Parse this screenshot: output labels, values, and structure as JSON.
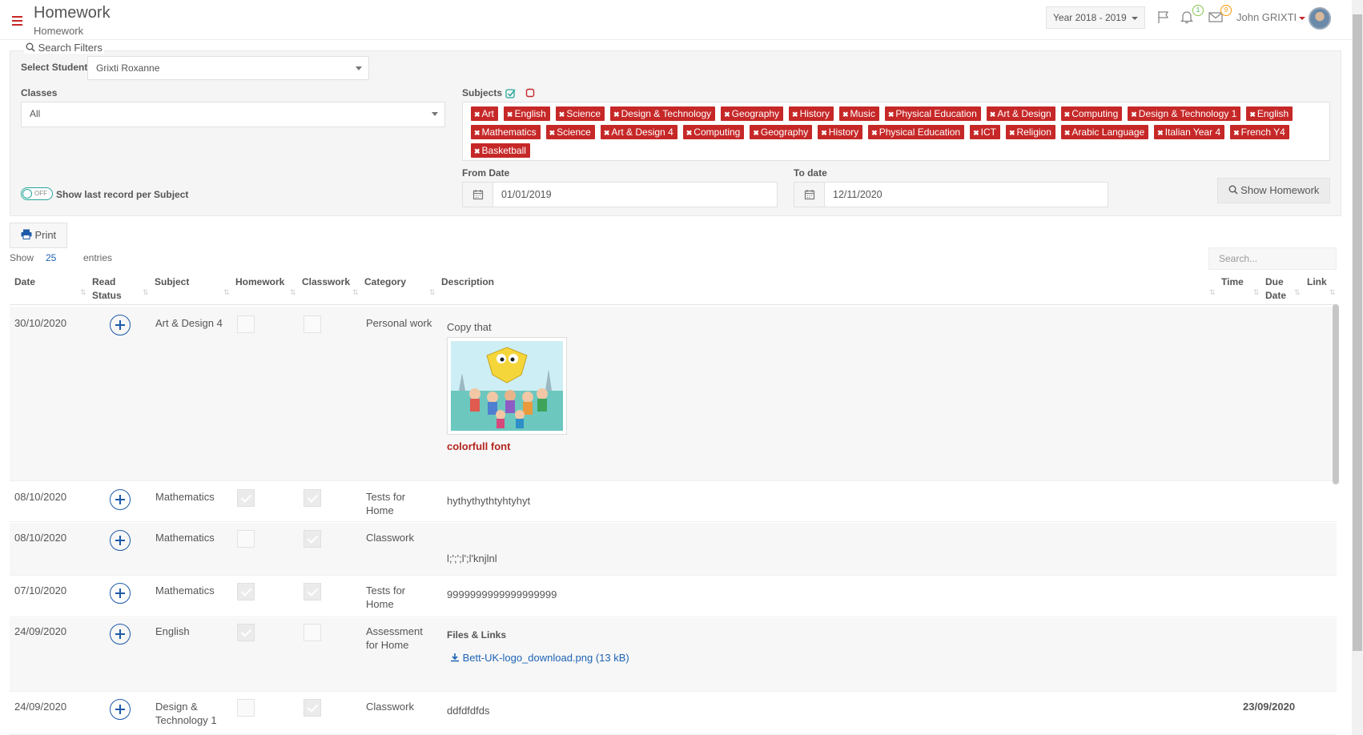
{
  "header": {
    "title": "Homework",
    "subtitle": "Homework",
    "year_select": "Year 2018 - 2019",
    "notifications_count": "1",
    "messages_count": "9",
    "user_name": "John GRIXTI"
  },
  "filters": {
    "title": "Search Filters",
    "select_student_label": "Select Student",
    "select_student_value": "Grixti Roxanne",
    "classes_label": "Classes",
    "classes_value": "All",
    "subjects_label": "Subjects",
    "subjects": [
      "Art",
      "English",
      "Science",
      "Design & Technology",
      "Geography",
      "History",
      "Music",
      "Physical Education",
      "Art & Design",
      "Computing",
      "Design & Technology 1",
      "English",
      "Mathematics",
      "Science",
      "Art & Design 4",
      "Computing",
      "Geography",
      "History",
      "Physical Education",
      "ICT",
      "Religion",
      "Arabic Language",
      "Italian Year 4",
      "French Y4",
      "Basketball"
    ],
    "toggle_state": "OFF",
    "toggle_label": "Show last record per Subject",
    "from_date_label": "From Date",
    "from_date_value": "01/01/2019",
    "to_date_label": "To date",
    "to_date_value": "12/11/2020",
    "show_button": "Show Homework"
  },
  "toolbar": {
    "print": "Print",
    "show_label": "Show",
    "entries_value": "25",
    "entries_label": "entries",
    "search_placeholder": "Search..."
  },
  "table": {
    "columns": {
      "date": "Date",
      "read": "Read",
      "status": "Status",
      "subject": "Subject",
      "homework": "Homework",
      "classwork": "Classwork",
      "category": "Category",
      "description": "Description",
      "time": "Time",
      "due": "Due",
      "date2": "Date",
      "link": "Link"
    },
    "rows": [
      {
        "date": "30/10/2020",
        "subject": "Art & Design 4",
        "subject2": "",
        "homework": false,
        "classwork": false,
        "category": "Personal work",
        "category2": "",
        "description": "Copy that",
        "note": "colorfull font",
        "due": ""
      },
      {
        "date": "08/10/2020",
        "subject": "Mathematics",
        "subject2": "",
        "homework": true,
        "classwork": true,
        "category": "Tests for",
        "category2": "Home",
        "description": "hythythythtyhtyhyt",
        "due": ""
      },
      {
        "date": "08/10/2020",
        "subject": "Mathematics",
        "subject2": "",
        "homework": false,
        "classwork": true,
        "category": "Classwork",
        "category2": "",
        "description": "l;';';l';l'knjlnl",
        "due": ""
      },
      {
        "date": "07/10/2020",
        "subject": "Mathematics",
        "subject2": "",
        "homework": true,
        "classwork": true,
        "category": "Tests for",
        "category2": "Home",
        "description": "9999999999999999999",
        "due": ""
      },
      {
        "date": "24/09/2020",
        "subject": "English",
        "subject2": "",
        "homework": true,
        "classwork": false,
        "category": "Assessment",
        "category2": "for Home",
        "files_label": "Files & Links",
        "file_link": "Bett-UK-logo_download.png (13 kB)",
        "due": ""
      },
      {
        "date": "24/09/2020",
        "subject": "Design &",
        "subject2": "Technology 1",
        "homework": false,
        "classwork": true,
        "category": "Classwork",
        "category2": "",
        "description": "ddfdfdfds",
        "due": "23/09/2020"
      }
    ]
  },
  "colors": {
    "accent": "#c62828",
    "link": "#1e63b4",
    "teal": "#26a69a"
  }
}
